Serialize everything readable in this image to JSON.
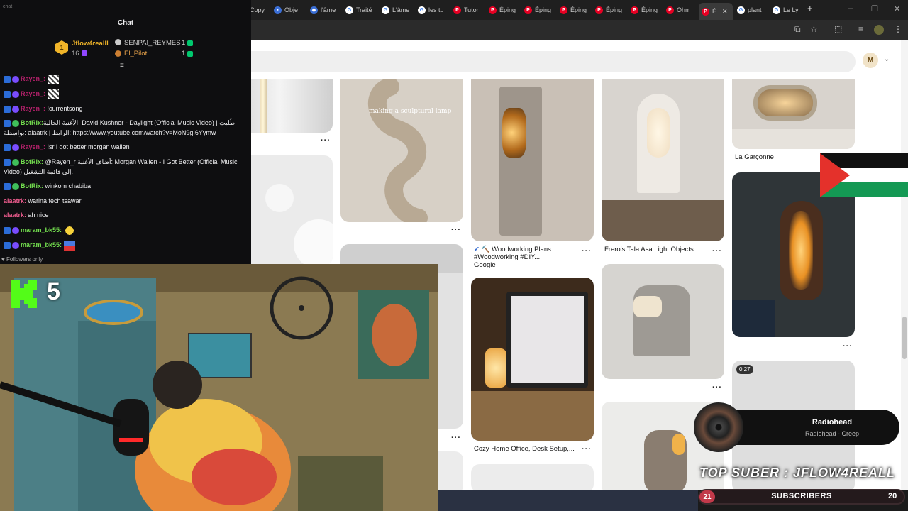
{
  "browser": {
    "tabs": [
      "Copy",
      "Obje",
      "l'âme",
      "Traité",
      "L'âme",
      "les tu",
      "Tutor",
      "Éping",
      "Éping",
      "Éping",
      "Éping",
      "Éping",
      "Ohm",
      "É",
      "plant",
      "Le Ly"
    ],
    "new_tab": "+",
    "window_controls": {
      "min": "–",
      "max": "❐",
      "close": "✕"
    },
    "avatar_letter": "M"
  },
  "pins": {
    "col3": [
      {
        "title": "La Garçonne"
      }
    ],
    "col1_caption": "making a sculptural lamp",
    "woodworking": {
      "title": "Woodworking Plans #Woodworking #DIY...",
      "source": "Google"
    },
    "frero": {
      "title": "Frero's Tala Asa Light Objects..."
    },
    "cozy": {
      "title": "Cozy Home Office, Desk Setup,..."
    },
    "video_badge": "0:27"
  },
  "chat": {
    "header_small": "chat",
    "title": "Chat",
    "leaderboard": {
      "first": {
        "name": "Jflow4realll",
        "count": "16"
      },
      "second": {
        "name": "SENPAI_REYMES",
        "count": "1"
      },
      "third": {
        "name": "El_Pilot",
        "count": "1"
      }
    },
    "messages": [
      {
        "user": "Rayen_:",
        "text": "",
        "color": "#b5216b"
      },
      {
        "user": "Rayen_:",
        "text": "",
        "color": "#b5216b"
      },
      {
        "user": "Rayen_:",
        "text": " !currentsong",
        "color": "#b5216b"
      },
      {
        "user": "BotRix:",
        "text": "الأغنية الحالية: David Kushner - Daylight (Official Music Video) | طُلبت بواسطة: alaatrk | الرابط: ",
        "link": "https://www.youtube.com/watch?v=MoN9gI6Yymw",
        "color": "#74e04f"
      },
      {
        "user": "Rayen_:",
        "text": " !sr i got better morgan wallen",
        "color": "#b5216b"
      },
      {
        "user": "BotRix:",
        "text": " @Rayen_r أضاف الأغنية: Morgan Wallen - I Got Better (Official Music Video) إلى قائمة التشغيل.",
        "color": "#74e04f"
      },
      {
        "user": "BotRix:",
        "text": " winkom chabiba",
        "color": "#74e04f"
      },
      {
        "user": "alaatrk:",
        "text": " warina fech tsawar",
        "color": "#e85a8a"
      },
      {
        "user": "alaatrk:",
        "text": " ah nice",
        "color": "#e85a8a"
      },
      {
        "user": "maram_bk55:",
        "text": "",
        "color": "#74e04f"
      },
      {
        "user": "maram_bk55:",
        "text": "",
        "color": "#74e04f"
      }
    ],
    "followers_only": "Followers only"
  },
  "overlay": {
    "kick_count": "5",
    "music": {
      "title": "Radiohead",
      "subtitle": "Radiohead - Creep"
    },
    "top_suber": "TOP SUBER : JFLOW4REALL",
    "subs": {
      "left": "21",
      "label": "SUBSCRIBERS",
      "right": "20"
    }
  },
  "colors": {
    "pinterest": "#e60023",
    "chat_bg": "#0e0e10",
    "twitch_gold": "#f0b429"
  }
}
